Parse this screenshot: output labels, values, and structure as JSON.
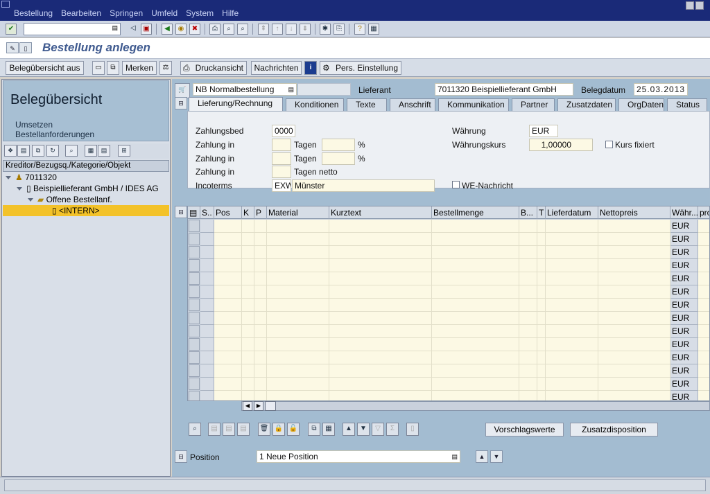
{
  "menu": [
    "Bestellung",
    "Bearbeiten",
    "Springen",
    "Umfeld",
    "System",
    "Hilfe"
  ],
  "title": "Bestellung anlegen",
  "app_toolbar": {
    "beleg_btn": "Belegübersicht aus",
    "merken": "Merken",
    "druckansicht": "Druckansicht",
    "nachrichten": "Nachrichten",
    "pers": "Pers. Einstellung"
  },
  "left": {
    "title": "Belegübersicht",
    "link1": "Umsetzen",
    "link2": "Bestellanforderungen",
    "tree_header": "Kreditor/Bezugsq./Kategorie/Objekt",
    "tree": [
      "7011320",
      "Beispiellieferant GmbH / IDES AG",
      "Offene Bestellanf.",
      "<INTERN>"
    ]
  },
  "header": {
    "doc_type": "NB Normalbestellung",
    "lieferant_label": "Lieferant",
    "lieferant": "7011320 Beispiellieferant GmbH",
    "belegdatum_label": "Belegdatum",
    "belegdatum": "25.03.2013"
  },
  "tabs": [
    "Lieferung/Rechnung",
    "Konditionen",
    "Texte",
    "Anschrift",
    "Kommunikation",
    "Partner",
    "Zusatzdaten",
    "OrgDaten",
    "Status"
  ],
  "form": {
    "zahlungsbed_label": "Zahlungsbed",
    "zahlungsbed": "0000",
    "zahlung_in": "Zahlung in",
    "tagen": "Tagen",
    "tagen_netto": "Tagen netto",
    "percent": "%",
    "incoterms_label": "Incoterms",
    "incoterms": "EXW",
    "incoterms_place": "Münster",
    "waehrung_label": "Währung",
    "waehrung": "EUR",
    "kurs_label": "Währungskurs",
    "kurs": "1,00000",
    "kurs_fixiert": "Kurs fixiert",
    "we_nachricht": "WE-Nachricht"
  },
  "grid": {
    "columns": [
      "S..",
      "Pos",
      "K",
      "P",
      "Material",
      "Kurztext",
      "Bestellmenge",
      "B...",
      "T",
      "Lieferdatum",
      "Nettopreis",
      "Währ...",
      "pro"
    ],
    "row_currency": "EUR",
    "row_count": 14
  },
  "bottom": {
    "vorschlag": "Vorschlagswerte",
    "zusatz": "Zusatzdisposition",
    "position_label": "Position",
    "position_value": "1 Neue Position"
  },
  "colors": {
    "accent": "#3f5a8f",
    "titlebar": "#1a2a78",
    "pane_bg": "#a3bcd1",
    "input_bg": "#fcf9e4",
    "tree_selected": "#f3c229"
  }
}
